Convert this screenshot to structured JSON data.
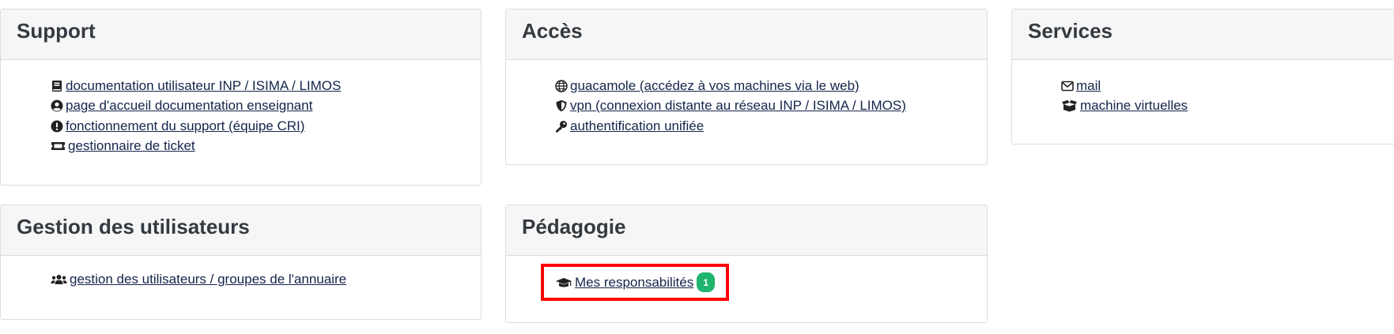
{
  "support": {
    "title": "Support",
    "links": [
      {
        "icon": "book-icon",
        "label": "documentation utilisateur INP / ISIMA / LIMOS"
      },
      {
        "icon": "user-circle-icon",
        "label": "page d'accueil documentation enseignant"
      },
      {
        "icon": "exclamation-circle-icon",
        "label": "fonctionnement du support (équipe CRI)"
      },
      {
        "icon": "ticket-icon",
        "label": "gestionnaire de ticket"
      }
    ]
  },
  "acces": {
    "title": "Accès",
    "links": [
      {
        "icon": "globe-icon",
        "label": "guacamole (accédez à vos machines via le web)"
      },
      {
        "icon": "shield-icon",
        "label": "vpn (connexion distante au réseau INP / ISIMA / LIMOS)"
      },
      {
        "icon": "key-icon",
        "label": "authentification unifiée"
      }
    ]
  },
  "services": {
    "title": "Services",
    "links": [
      {
        "icon": "envelope-icon",
        "label": "mail"
      },
      {
        "icon": "boxes-icon",
        "label": "machine virtuelles"
      }
    ]
  },
  "gestion": {
    "title": "Gestion des utilisateurs",
    "links": [
      {
        "icon": "users-icon",
        "label": "gestion des utilisateurs / groupes de l'annuaire"
      }
    ]
  },
  "pedagogie": {
    "title": "Pédagogie",
    "links": [
      {
        "icon": "graduation-cap-icon",
        "label": "Mes responsabilités",
        "badge": "1"
      }
    ]
  },
  "colors": {
    "link": "#14244a",
    "header_bg": "#f6f6f6",
    "badge": "#20b56e",
    "highlight": "#ff0000"
  }
}
